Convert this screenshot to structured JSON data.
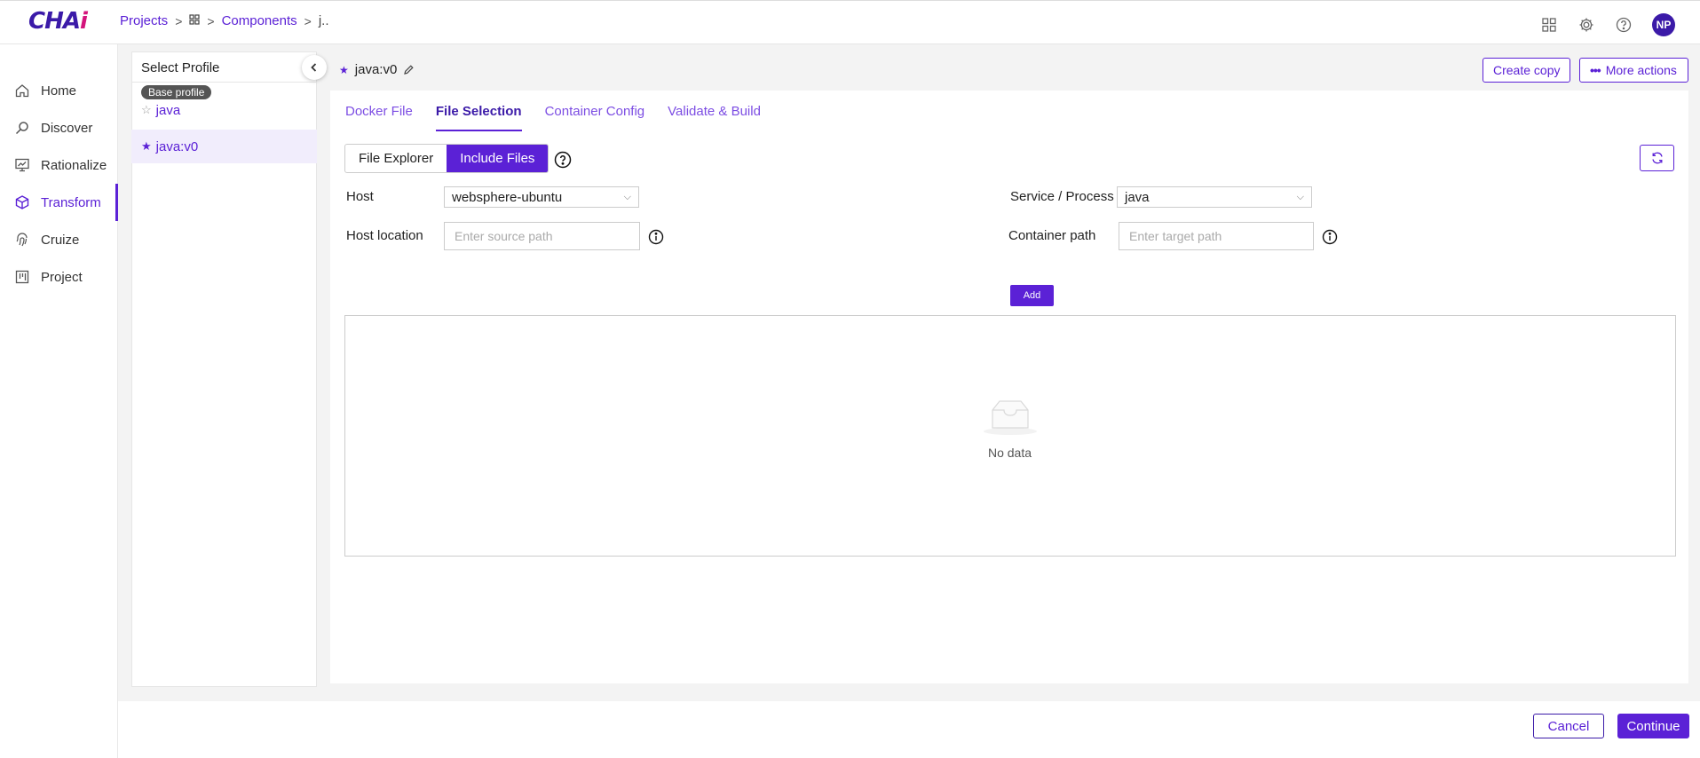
{
  "app": {
    "logo": "CHA",
    "logo_accent": "i"
  },
  "breadcrumb": {
    "projects": "Projects",
    "components": "Components",
    "current": "j.."
  },
  "header": {
    "avatar_initials": "NP"
  },
  "sidebar": {
    "items": [
      {
        "label": "Home",
        "icon": "home-icon"
      },
      {
        "label": "Discover",
        "icon": "search-icon"
      },
      {
        "label": "Rationalize",
        "icon": "chart-board-icon"
      },
      {
        "label": "Transform",
        "icon": "cube-icon",
        "active": true
      },
      {
        "label": "Cruize",
        "icon": "fingerprint-icon"
      },
      {
        "label": "Project",
        "icon": "kanban-icon"
      }
    ]
  },
  "profiles": {
    "title": "Select Profile",
    "base_badge": "Base profile",
    "items": [
      {
        "label": "java",
        "starred": false
      },
      {
        "label": "java:v0",
        "starred": true,
        "selected": true
      }
    ]
  },
  "content": {
    "title": "java:v0",
    "create_copy": "Create copy",
    "more_actions": "More actions",
    "tabs": [
      "Docker File",
      "File Selection",
      "Container Config",
      "Validate & Build"
    ],
    "active_tab": "File Selection",
    "modes": [
      "File Explorer",
      "Include Files"
    ],
    "active_mode": "Include Files",
    "host_label": "Host",
    "host_value": "websphere-ubuntu",
    "service_label": "Service / Process",
    "service_value": "java",
    "host_location_label": "Host location",
    "host_location_placeholder": "Enter source path",
    "container_path_label": "Container path",
    "container_path_placeholder": "Enter target path",
    "add": "Add",
    "empty_text": "No data"
  },
  "footer": {
    "cancel": "Cancel",
    "continue": "Continue"
  },
  "colors": {
    "accent": "#5b21d6",
    "brand_dark": "#3b1aa8",
    "logo_pink": "#d4147c"
  }
}
